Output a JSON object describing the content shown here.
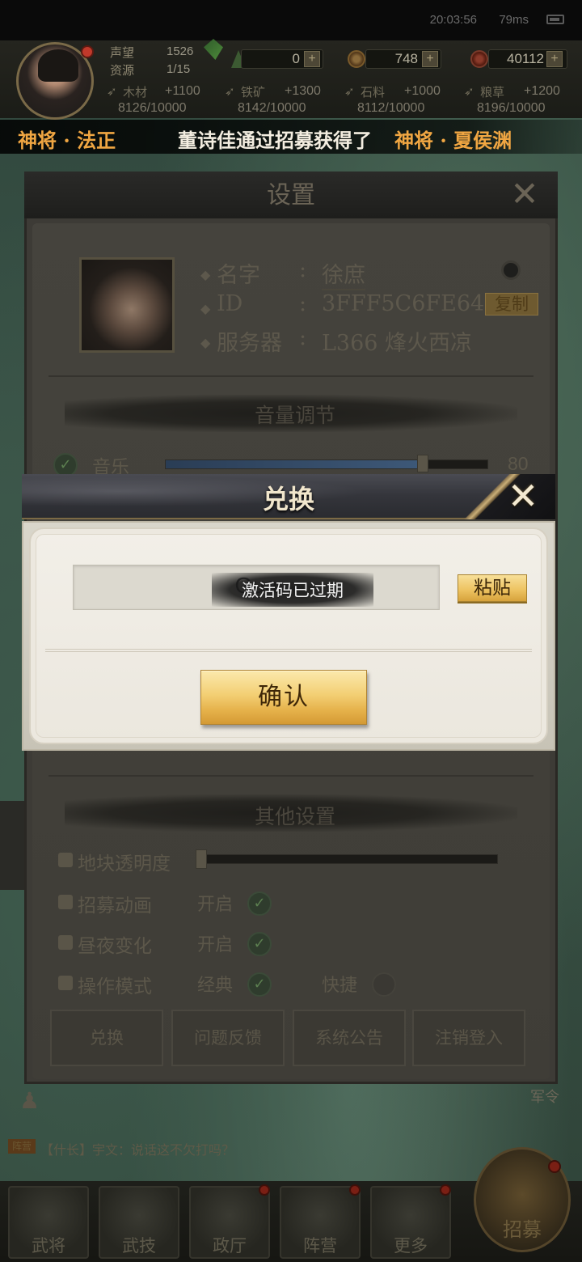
{
  "status_bar": {
    "time": "20:03:56",
    "network": "79ms"
  },
  "top_bar": {
    "prestige_label": "声望",
    "prestige_value": "1526",
    "resource_label": "资源",
    "resource_value": "1/15",
    "currency1": "0",
    "currency2": "748",
    "currency3": "40112",
    "plus": "+",
    "crops": [
      {
        "name": "木材",
        "rate": "+1100",
        "count": "8126/10000"
      },
      {
        "name": "铁矿",
        "rate": "+1300",
        "count": "8142/10000"
      },
      {
        "name": "石料",
        "rate": "+1000",
        "count": "8112/10000"
      },
      {
        "name": "粮草",
        "rate": "+1200",
        "count": "8196/10000"
      }
    ]
  },
  "ticker": {
    "left_name": "神将 · 法正",
    "message_prefix": "董诗佳通过招募获得了",
    "message_general": "神将 · 夏侯渊"
  },
  "settings": {
    "title": "设置",
    "close": "✕",
    "profile": {
      "name_label": "名字",
      "name_value": "徐庶",
      "id_label": "ID",
      "id_value": "3FFF5C6FE64",
      "server_label": "服务器",
      "server_value": "L366 烽火西凉",
      "colon": ":",
      "copy_label": "复制"
    },
    "volume_section": "音量调节",
    "music_label": "音乐",
    "music_value": "80",
    "other_section": "其他设置",
    "tile_opacity_label": "地块透明度",
    "recruit_anim_label": "招募动画",
    "recruit_anim_value": "开启",
    "day_night_label": "昼夜变化",
    "day_night_value": "开启",
    "op_mode_label": "操作模式",
    "op_mode_classic": "经典",
    "op_mode_quick": "快捷",
    "buttons": [
      "兑换",
      "问题反馈",
      "系统公告",
      "注销登入"
    ]
  },
  "redeem_dialog": {
    "title": "兑换",
    "close": "✕",
    "code_value": "GuaNxxx666",
    "code_visible": "Gua",
    "toast": "激活码已过期",
    "paste_label": "粘贴",
    "confirm_label": "确认"
  },
  "chat": {
    "tag": "阵营",
    "text": "【什长】宇文：说话这不欠打吗？"
  },
  "bottom_nav": {
    "items": [
      "武将",
      "武技",
      "政厅",
      "阵营",
      "更多"
    ],
    "recruit": "招募",
    "legion": "军令"
  }
}
